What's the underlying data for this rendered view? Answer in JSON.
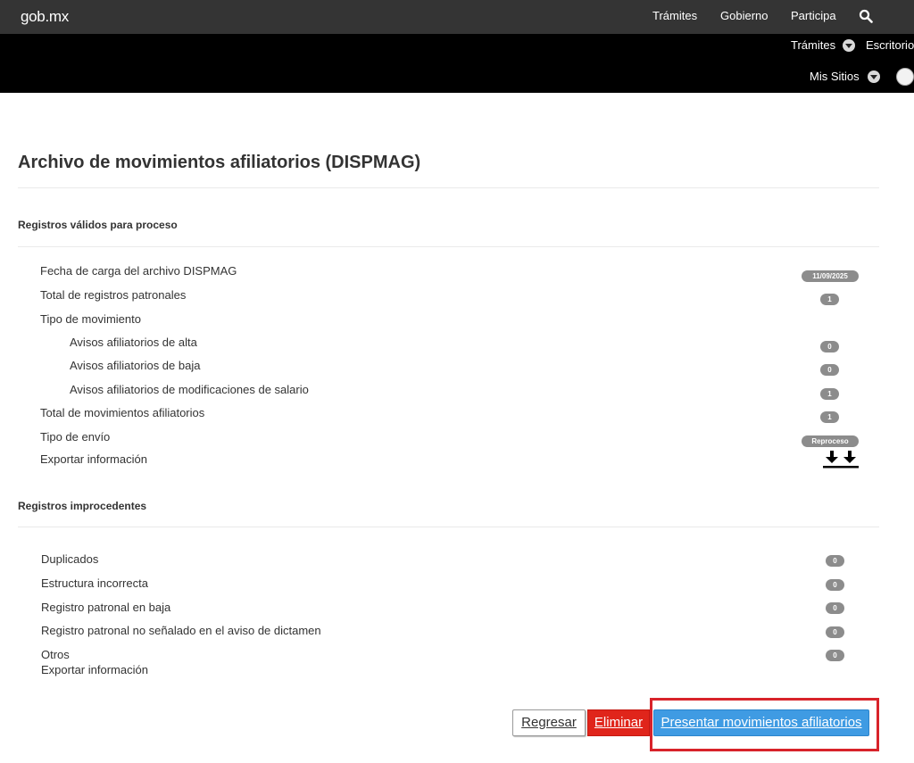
{
  "header": {
    "logo": "gob.mx",
    "nav": [
      "Trámites",
      "Gobierno",
      "Participa"
    ],
    "search_icon": "search-icon"
  },
  "subheader": {
    "tramites": "Trámites",
    "escritorio": "Escritorio",
    "mis_sitios": "Mis Sitios"
  },
  "page": {
    "title": "Archivo de movimientos afiliatorios (DISPMAG)"
  },
  "valid": {
    "section_title": "Registros válidos para proceso",
    "rows": [
      {
        "label": "Fecha de carga del archivo DISPMAG",
        "value": "11/09/2025"
      },
      {
        "label": "Total de registros patronales",
        "value": "1"
      },
      {
        "label": "Tipo de movimiento",
        "value": ""
      },
      {
        "label": "Avisos afiliatorios de alta",
        "value": "0"
      },
      {
        "label": "Avisos afiliatorios de baja",
        "value": "0"
      },
      {
        "label": "Avisos afiliatorios de modificaciones de salario",
        "value": "1"
      },
      {
        "label": "Total de movimientos afiliatorios",
        "value": "1"
      },
      {
        "label": "Tipo de envío",
        "value": "Reproceso"
      },
      {
        "label": "Exportar información",
        "value": ""
      }
    ]
  },
  "invalid": {
    "section_title": "Registros improcedentes",
    "rows": [
      {
        "label": "Duplicados",
        "value": "0"
      },
      {
        "label": "Estructura incorrecta",
        "value": "0"
      },
      {
        "label": "Registro patronal en baja",
        "value": "0"
      },
      {
        "label": "Registro patronal no señalado en el aviso de dictamen",
        "value": "0"
      },
      {
        "label": "Otros",
        "value": "0"
      },
      {
        "label": "Exportar información",
        "value": ""
      }
    ]
  },
  "actions": {
    "back": "Regresar",
    "delete": "Eliminar",
    "submit": "Presentar movimientos afiliatorios"
  },
  "colors": {
    "topbar": "#343434",
    "subbar": "#000000",
    "badge": "#8c8c8c",
    "delete": "#e0251b",
    "submit": "#3f9be3",
    "highlight": "#d8232a"
  }
}
